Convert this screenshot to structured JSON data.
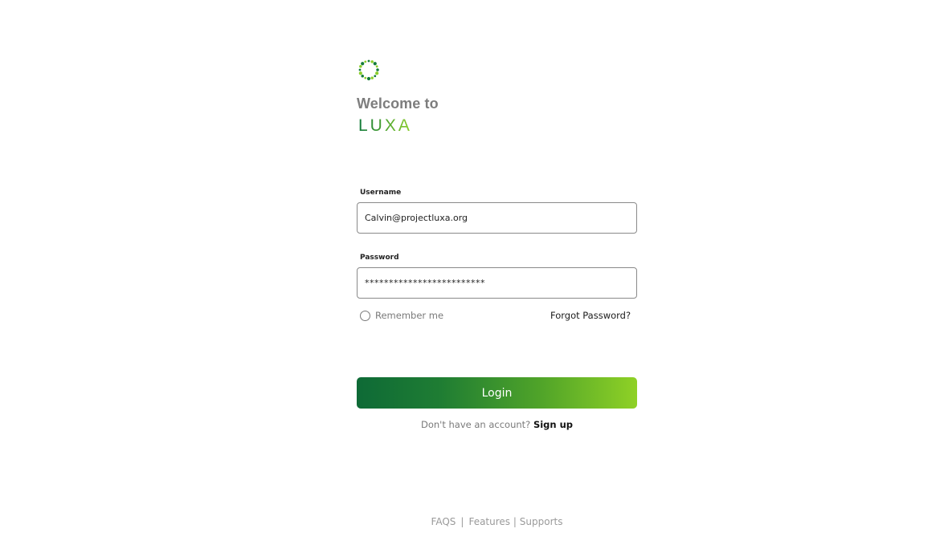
{
  "header": {
    "logo_icon": "luxa-dotted-ring-logo",
    "welcome_text": "Welcome to",
    "brand_name": "LUXA",
    "brand_color_dark": "#127a3a",
    "brand_color_light": "#8ccf2a"
  },
  "form": {
    "username_label": "Username",
    "username_value": "Calvin@projectluxa.org",
    "password_label": "Password",
    "password_value": "*************************",
    "remember_label": "Remember me",
    "remember_checked": false,
    "forgot_label": "Forgot Password?",
    "login_label": "Login",
    "signup_prompt": "Don't have an account?",
    "signup_label": "Sign up"
  },
  "footer": {
    "faqs": "FAQS",
    "separator_1": "|",
    "features": "Features",
    "separator_2": "|",
    "supports": "Supports"
  }
}
